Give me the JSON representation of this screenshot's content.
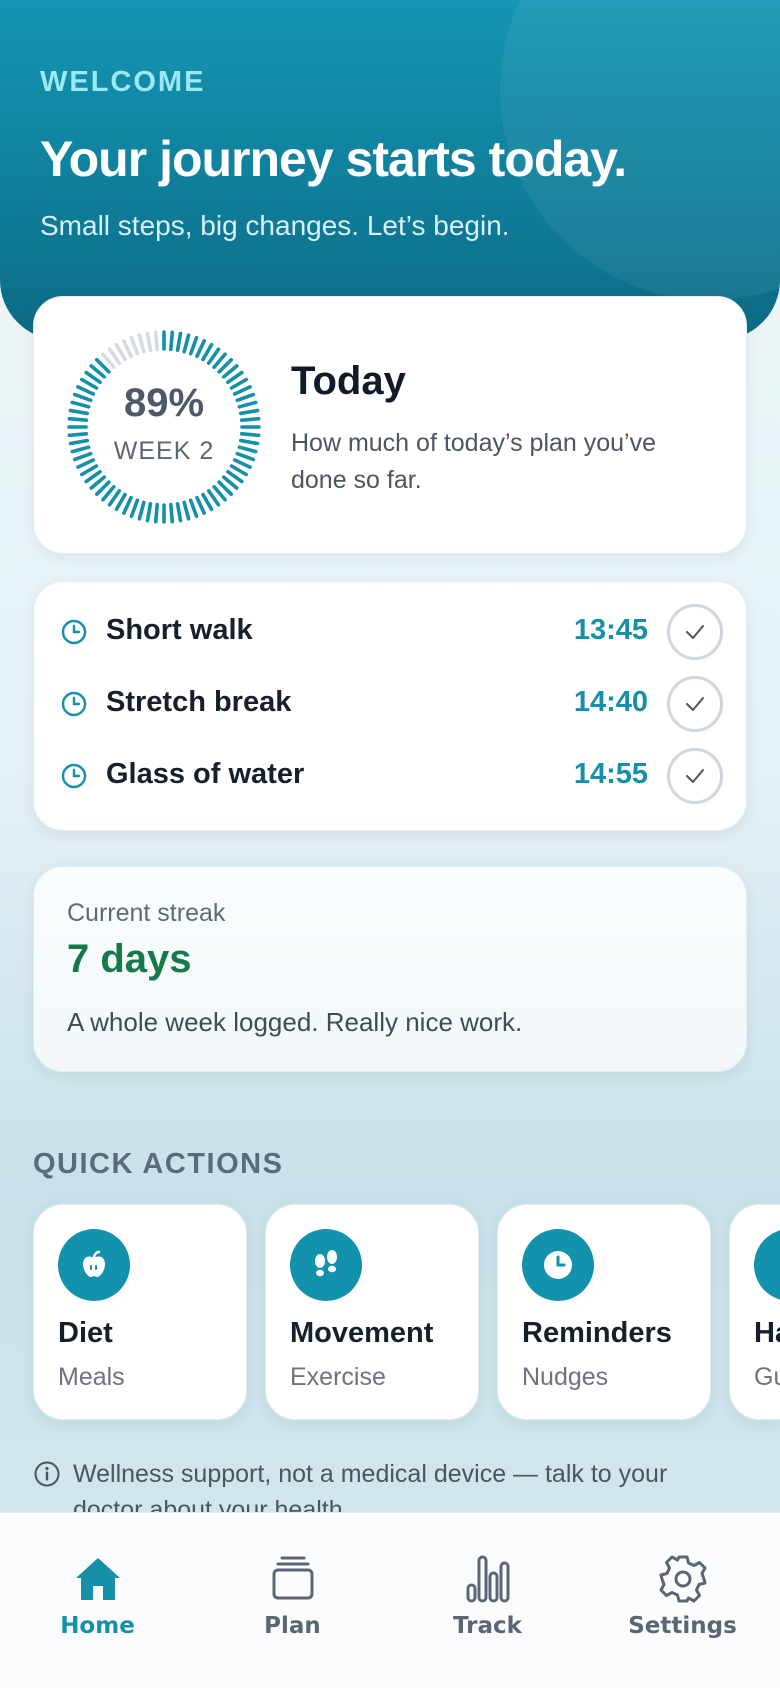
{
  "hero": {
    "eyebrow": "WELCOME",
    "title": "Your journey starts today.",
    "subtitle": "Small steps, big changes. Let’s begin."
  },
  "today": {
    "progress_percent_text": "89%",
    "progress_fraction": 0.89,
    "week_label": "WEEK 2",
    "title": "Today",
    "description": "How much of today’s plan you’ve done so far."
  },
  "tasks": [
    {
      "name": "Short walk",
      "time": "13:45",
      "icon": "clock-icon",
      "done_icon": "check-icon"
    },
    {
      "name": "Stretch break",
      "time": "14:40",
      "icon": "clock-icon",
      "done_icon": "check-icon"
    },
    {
      "name": "Glass of water",
      "time": "14:55",
      "icon": "clock-icon",
      "done_icon": "check-icon"
    }
  ],
  "streak": {
    "label": "Current streak",
    "value": "7 days",
    "note": "A whole week logged. Really nice work."
  },
  "quick_actions": {
    "title": "QUICK ACTIONS",
    "items": [
      {
        "label": "Diet",
        "sub": "Meals",
        "icon": "apple-icon"
      },
      {
        "label": "Movement",
        "sub": "Exercise",
        "icon": "footprints-icon"
      },
      {
        "label": "Reminders",
        "sub": "Nudges",
        "icon": "clock-icon"
      },
      {
        "label": "Ha",
        "sub": "Gu",
        "icon": "partial-icon"
      }
    ]
  },
  "disclaimer": {
    "icon": "info-icon",
    "text": "Wellness support, not a medical device — talk to your doctor about your health."
  },
  "tabbar": {
    "items": [
      {
        "label": "Home",
        "icon": "home-icon",
        "active": true
      },
      {
        "label": "Plan",
        "icon": "stack-icon",
        "active": false
      },
      {
        "label": "Track",
        "icon": "bar-chart-icon",
        "active": false
      },
      {
        "label": "Settings",
        "icon": "gear-icon",
        "active": false
      }
    ]
  },
  "colors": {
    "accent": "#1590a8",
    "hero": "#0f7f9b",
    "streak_green": "#157a4a",
    "ring_inactive": "#d5dbe2"
  }
}
